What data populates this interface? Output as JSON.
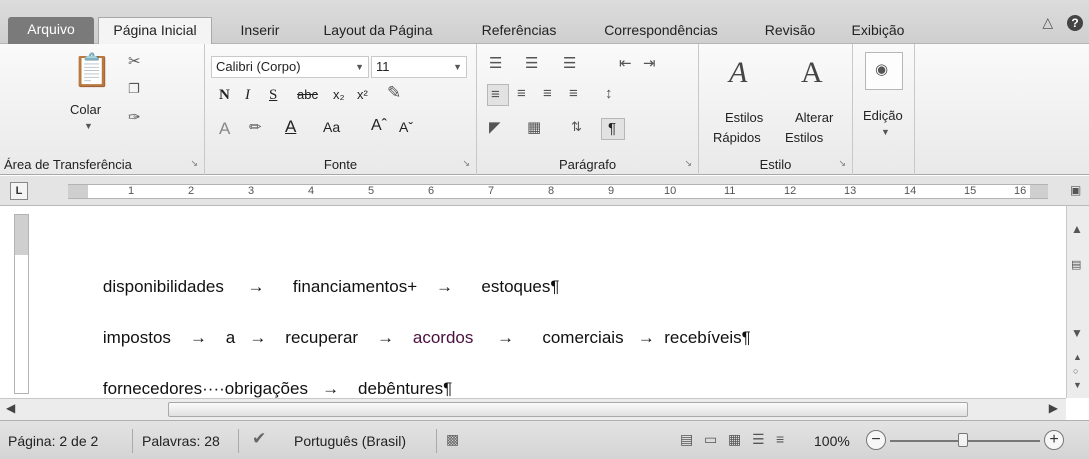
{
  "tabs": {
    "file": "Arquivo",
    "home": "Página Inicial",
    "insert": "Inserir",
    "layout": "Layout da Página",
    "references": "Referências",
    "mailings": "Correspondências",
    "review": "Revisão",
    "view": "Exibição"
  },
  "ribbon": {
    "clipboard": {
      "paste": "Colar",
      "label": "Área de Transferência"
    },
    "font": {
      "name": "Calibri (Corpo)",
      "size": "11",
      "label": "Fonte"
    },
    "paragraph": {
      "label": "Parágrafo"
    },
    "styles": {
      "quick1": "Estilos",
      "quick2": "Rápidos",
      "change1": "Alterar",
      "change2": "Estilos",
      "label": "Estilo"
    },
    "editing": {
      "label": "Edição"
    }
  },
  "ruler": {
    "ticks": [
      "1",
      "2",
      "3",
      "4",
      "5",
      "6",
      "7",
      "8",
      "9",
      "10",
      "11",
      "12",
      "13",
      "14",
      "15",
      "16"
    ]
  },
  "document": {
    "line1": {
      "a": "disponibilidades",
      "b": "financiamentos+",
      "c": "estoques¶"
    },
    "line2": {
      "a": "impostos",
      "b": "a",
      "c": "recuperar",
      "d": "acordos",
      "e": "comerciais",
      "f": "recebíveis¶"
    },
    "line3": {
      "a": "fornecedores····obrigações",
      "b": "debêntures¶"
    },
    "arrow": "→"
  },
  "status": {
    "page": "Página: 2 de 2",
    "words": "Palavras: 28",
    "language": "Português (Brasil)",
    "zoom": "100%"
  },
  "colors": {
    "file_tab": "#7a7a7a",
    "purple_word": "#4a1040"
  }
}
